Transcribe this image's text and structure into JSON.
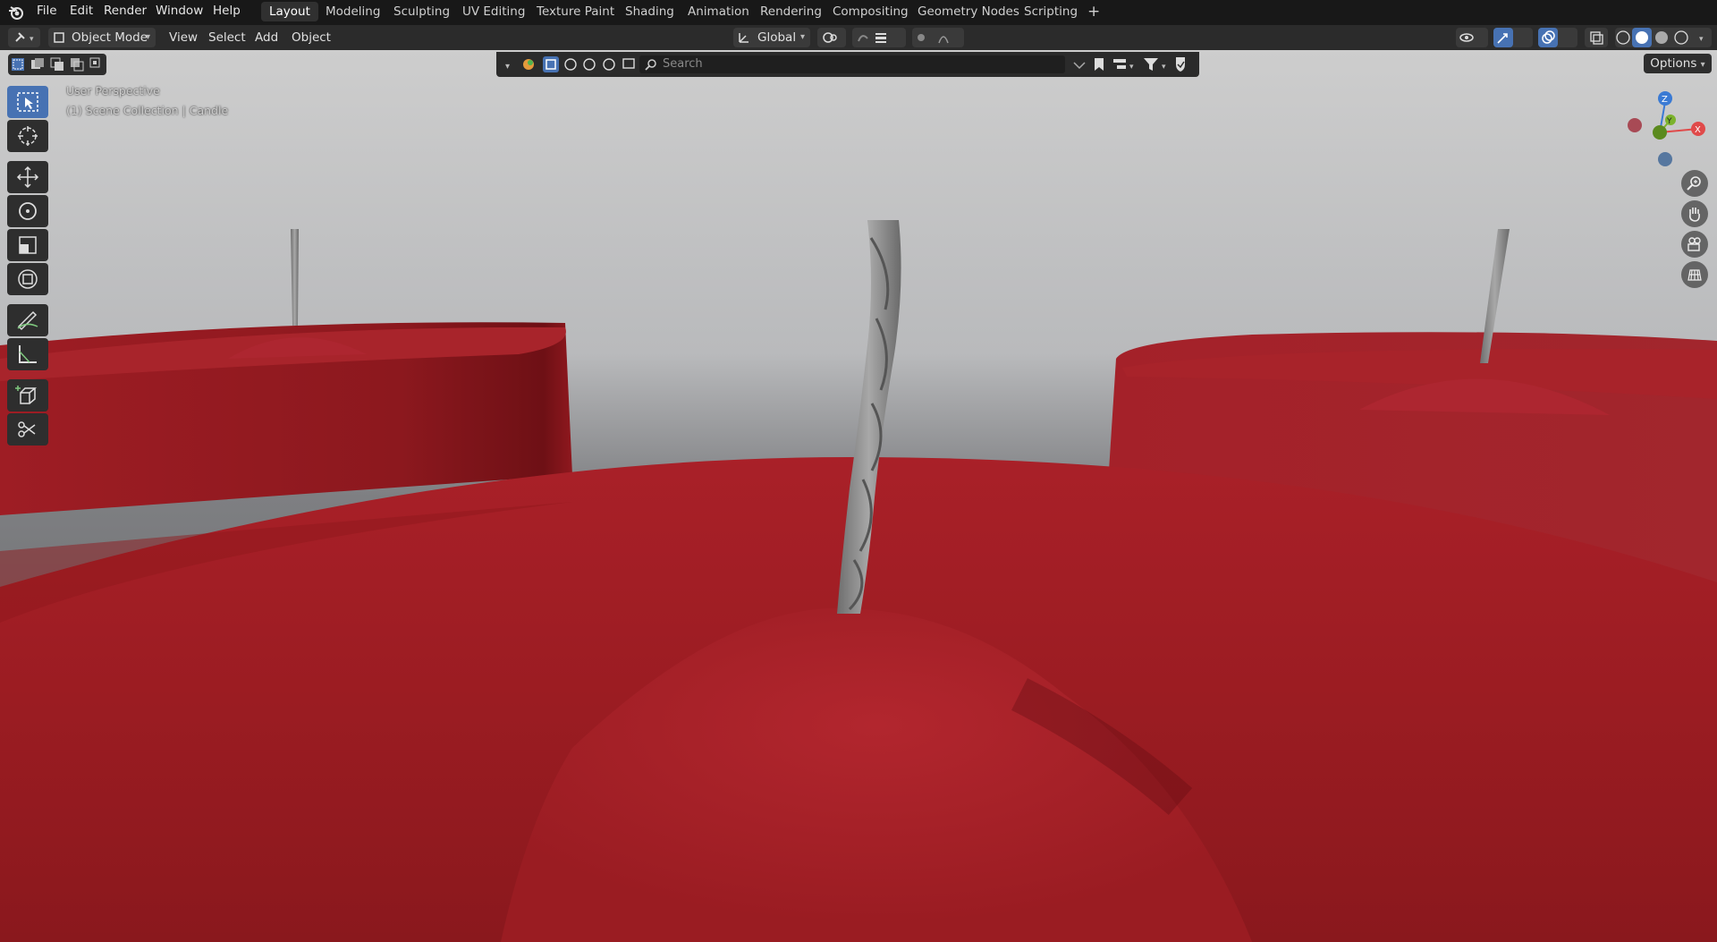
{
  "menu": [
    "File",
    "Edit",
    "Render",
    "Window",
    "Help"
  ],
  "workspaces": [
    "Layout",
    "Modeling",
    "Sculpting",
    "UV Editing",
    "Texture Paint",
    "Shading",
    "Animation",
    "Rendering",
    "Compositing",
    "Geometry Nodes",
    "Scripting"
  ],
  "active_workspace": "Layout",
  "header": {
    "mode": "Object Mode",
    "view_menu": [
      "View",
      "Select",
      "Add",
      "Object"
    ],
    "orientation": "Global",
    "search_placeholder": "Search",
    "options_label": "Options"
  },
  "viewport": {
    "perspective_label": "User Perspective",
    "collection_label": "(1) Scene Collection | Candle",
    "gizmo": {
      "z": "Z",
      "y": "Y",
      "x": "X"
    }
  },
  "colors": {
    "candle_red": "#9c1e24",
    "wick_grey": "#8c8c8c",
    "accent_blue": "#4772b3"
  }
}
